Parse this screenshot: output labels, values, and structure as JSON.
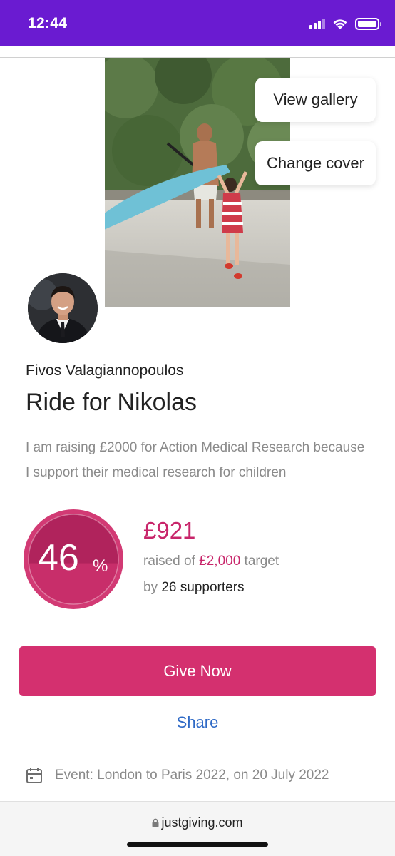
{
  "status_bar": {
    "time": "12:44",
    "icons": [
      "signal-icon",
      "wifi-icon",
      "battery-icon"
    ]
  },
  "cover": {
    "view_gallery_label": "View gallery",
    "change_cover_label": "Change cover"
  },
  "owner": {
    "name": "Fivos Valagiannopoulos"
  },
  "page": {
    "title": "Ride for Nikolas",
    "description": "I am raising £2000 for Action Medical Research because I support their medical research for children"
  },
  "progress": {
    "percent": 46,
    "percent_label": "46",
    "percent_sign": "%",
    "raised": "£921",
    "raised_prefix": "raised of ",
    "target": "£2,000",
    "target_suffix": " target",
    "supporters_prefix": "by ",
    "supporters": "26 supporters"
  },
  "actions": {
    "give_now_label": "Give Now",
    "share_label": "Share"
  },
  "event": {
    "text": "Event: London to Paris 2022, on 20 July 2022",
    "icon": "calendar-icon"
  },
  "browser": {
    "url": "justgiving.com",
    "icon": "lock-icon"
  },
  "colors": {
    "status_bar": "#6a1bd1",
    "accent": "#c8256a",
    "button": "#d4306f",
    "link": "#2f6ac6"
  }
}
